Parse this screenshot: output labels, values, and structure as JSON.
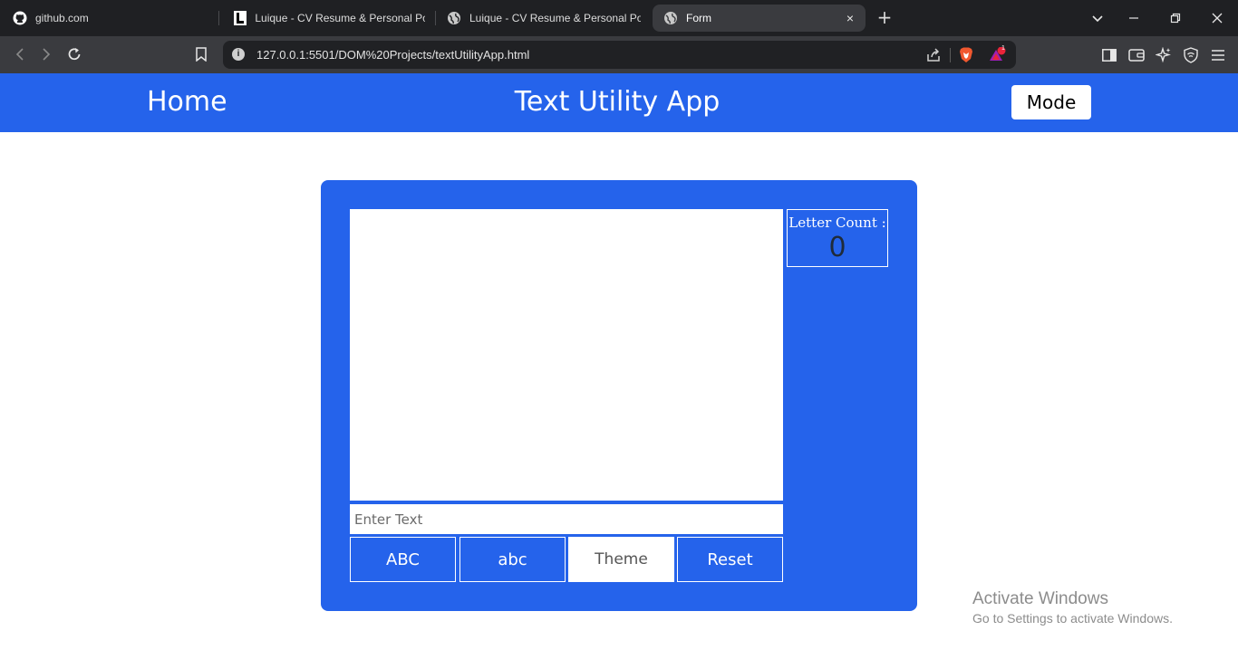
{
  "browser": {
    "tabs": [
      {
        "label": "github.com",
        "icon": "github-icon",
        "active": false
      },
      {
        "label": "Luique - CV Resume & Personal Por",
        "icon": "luique-favicon",
        "active": false
      },
      {
        "label": "Luique - CV Resume & Personal Por",
        "icon": "globe-icon",
        "active": false
      },
      {
        "label": "Form",
        "icon": "globe-icon",
        "active": true
      }
    ],
    "new_tab_glyph": "+",
    "close_glyph": "×",
    "url": "127.0.0.1:5501/DOM%20Projects/textUtilityApp.html",
    "info_glyph": "i",
    "notification_count": "1"
  },
  "header": {
    "home_label": "Home",
    "title": "Text Utility App",
    "mode_label": "Mode",
    "color": "#2563eb"
  },
  "main": {
    "textarea_value": "",
    "input_placeholder": "Enter Text",
    "letter_count_label": "Letter Count :",
    "letter_count_value": "0",
    "buttons": [
      {
        "label": "ABC"
      },
      {
        "label": "abc"
      },
      {
        "label": "Theme"
      },
      {
        "label": "Reset"
      }
    ]
  },
  "watermark": {
    "line1": "Activate Windows",
    "line2": "Go to Settings to activate Windows."
  }
}
